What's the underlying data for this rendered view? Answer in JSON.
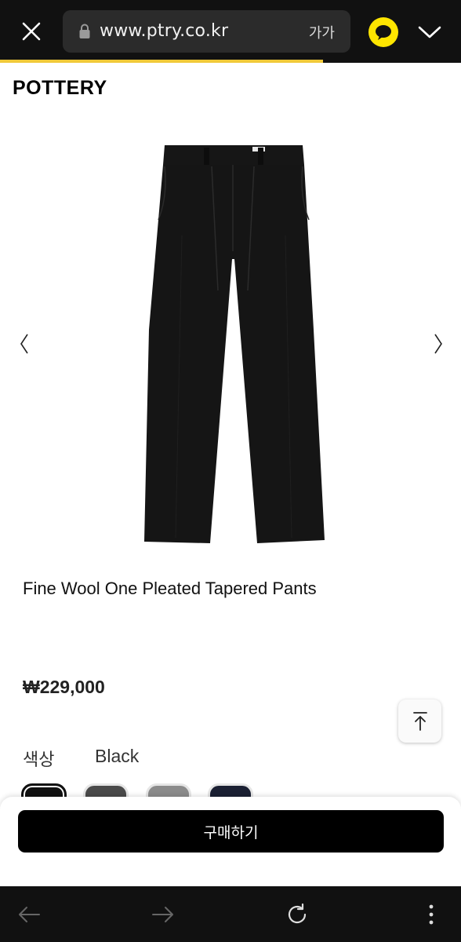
{
  "browser": {
    "url": "www.ptry.co.kr",
    "font_size_label": "가가",
    "close_icon": "close-icon",
    "lock_icon": "lock-icon",
    "talk_icon": "chat-bubble-icon",
    "expand_icon": "chevron-down-icon",
    "load_progress": 0.7
  },
  "site": {
    "logo": "POTTERY"
  },
  "product": {
    "image_icon": "pants-image",
    "prev_icon": "chevron-left-icon",
    "next_icon": "chevron-right-icon",
    "name": "Fine Wool One Pleated Tapered Pants",
    "price": "₩229,000",
    "color_label": "색상",
    "selected_color": "Black",
    "swatches": [
      {
        "name": "black",
        "color": "#111111",
        "selected": true
      },
      {
        "name": "charcoal",
        "color": "#4a4a4a",
        "selected": false
      },
      {
        "name": "gray",
        "color": "#8b8b8b",
        "selected": false
      },
      {
        "name": "navy",
        "color": "#1b2033",
        "selected": false
      }
    ]
  },
  "scroll_top_icon": "arrow-up-to-line-icon",
  "purchase": {
    "buy_label": "구매하기"
  },
  "bottom_nav": {
    "back_icon": "arrow-left-icon",
    "forward_icon": "arrow-right-icon",
    "reload_icon": "reload-icon",
    "more_icon": "more-vertical-icon"
  },
  "colors": {
    "accent_progress": "#f0c93a",
    "kakao_yellow": "#fee500",
    "bar_background": "#111111"
  }
}
